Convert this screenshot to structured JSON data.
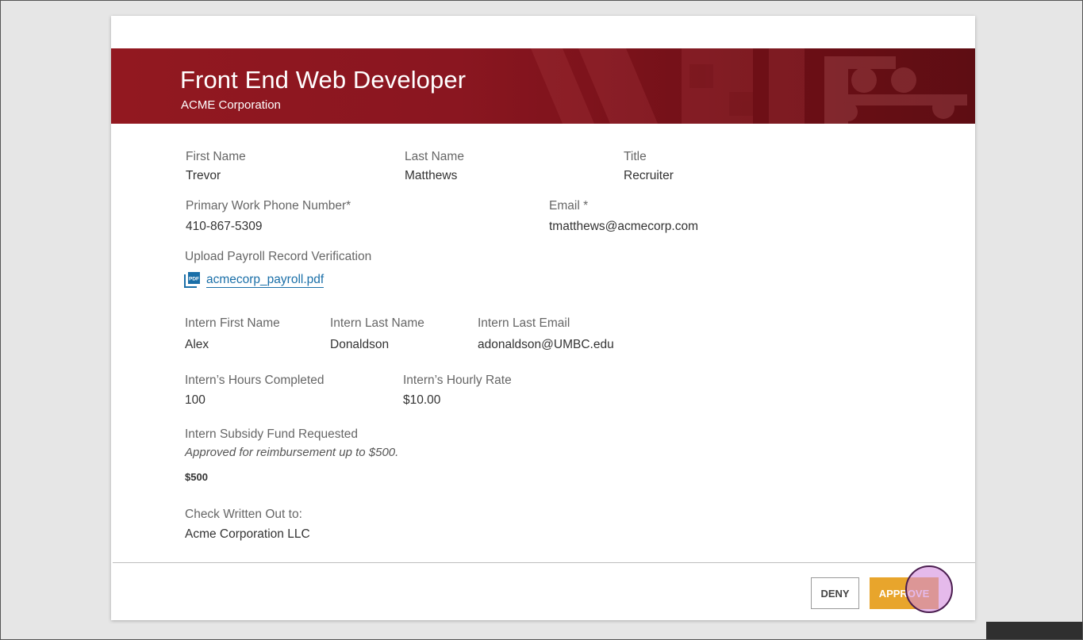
{
  "banner": {
    "job_title": "Front End Web Developer",
    "company": "ACME Corporation"
  },
  "contact": {
    "first_name_label": "First Name",
    "first_name": "Trevor",
    "last_name_label": "Last Name",
    "last_name": "Matthews",
    "title_label": "Title",
    "title": "Recruiter",
    "phone_label": "Primary Work Phone Number*",
    "phone": "410-867-5309",
    "email_label": "Email *",
    "email": "tmatthews@acmecorp.com"
  },
  "payroll": {
    "label": "Upload Payroll Record Verification",
    "file_name": "acmecorp_payroll.pdf",
    "file_icon": "pdf-icon"
  },
  "intern": {
    "first_name_label": "Intern First Name",
    "first_name": "Alex",
    "last_name_label": "Intern Last Name",
    "last_name": "Donaldson",
    "email_label": "Intern Last Email",
    "email": "adonaldson@UMBC.edu",
    "hours_label": "Intern’s Hours Completed",
    "hours": "100",
    "rate_label": "Intern’s Hourly Rate",
    "rate": "$10.00"
  },
  "subsidy": {
    "label": "Intern Subsidy Fund Requested",
    "note": "Approved for reimbursement up to $500.",
    "amount": "$500"
  },
  "check": {
    "label": "Check Written Out to:",
    "payee": "Acme Corporation LLC"
  },
  "actions": {
    "deny_label": "DENY",
    "approve_label": "APPROVE"
  },
  "colors": {
    "banner": "#921820",
    "approve": "#e8a52c",
    "link": "#1a6fa8"
  }
}
